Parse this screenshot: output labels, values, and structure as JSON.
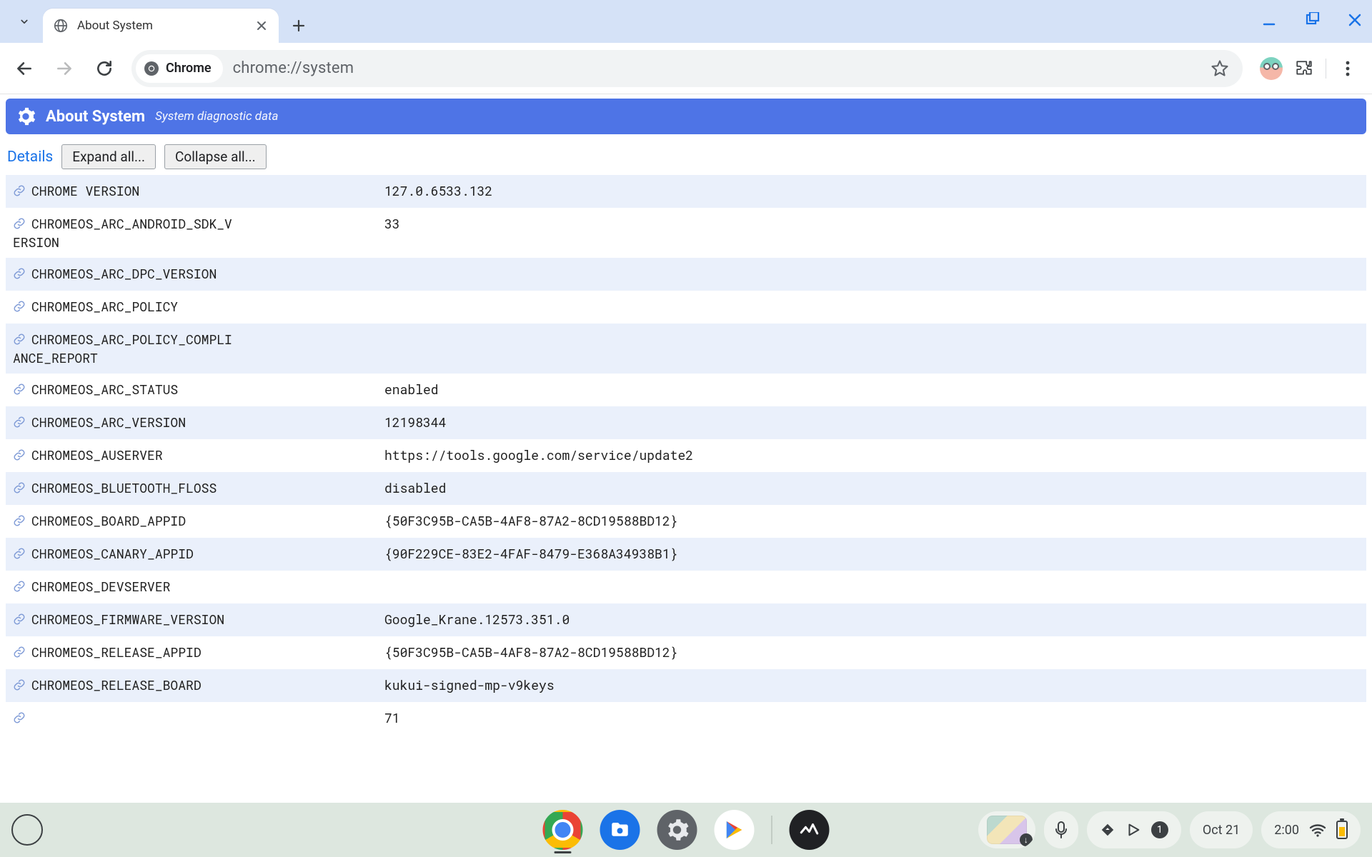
{
  "window": {
    "tab_title": "About System",
    "url": "chrome://system",
    "chip_label": "Chrome"
  },
  "banner": {
    "title": "About System",
    "subtitle": "System diagnostic data"
  },
  "controls": {
    "details": "Details",
    "expand": "Expand all...",
    "collapse": "Collapse all..."
  },
  "rows": [
    {
      "key": "CHROME VERSION",
      "value": "127.0.6533.132"
    },
    {
      "key": "CHROMEOS_ARC_ANDROID_SDK_VERSION",
      "value": "33"
    },
    {
      "key": "CHROMEOS_ARC_DPC_VERSION",
      "value": ""
    },
    {
      "key": "CHROMEOS_ARC_POLICY",
      "value": ""
    },
    {
      "key": "CHROMEOS_ARC_POLICY_COMPLIANCE_REPORT",
      "value": ""
    },
    {
      "key": "CHROMEOS_ARC_STATUS",
      "value": "enabled"
    },
    {
      "key": "CHROMEOS_ARC_VERSION",
      "value": "12198344"
    },
    {
      "key": "CHROMEOS_AUSERVER",
      "value": "https://tools.google.com/service/update2"
    },
    {
      "key": "CHROMEOS_BLUETOOTH_FLOSS",
      "value": "disabled"
    },
    {
      "key": "CHROMEOS_BOARD_APPID",
      "value": "{50F3C95B-CA5B-4AF8-87A2-8CD19588BD12}"
    },
    {
      "key": "CHROMEOS_CANARY_APPID",
      "value": "{90F229CE-83E2-4FAF-8479-E368A34938B1}"
    },
    {
      "key": "CHROMEOS_DEVSERVER",
      "value": ""
    },
    {
      "key": "CHROMEOS_FIRMWARE_VERSION",
      "value": "Google_Krane.12573.351.0"
    },
    {
      "key": "CHROMEOS_RELEASE_APPID",
      "value": "{50F3C95B-CA5B-4AF8-87A2-8CD19588BD12}"
    },
    {
      "key": "CHROMEOS_RELEASE_BOARD",
      "value": "kukui-signed-mp-v9keys"
    },
    {
      "key": "",
      "value": "71"
    }
  ],
  "shelf": {
    "notification_count": "1",
    "date": "Oct 21",
    "time": "2:00",
    "tote_badge": "↓"
  }
}
